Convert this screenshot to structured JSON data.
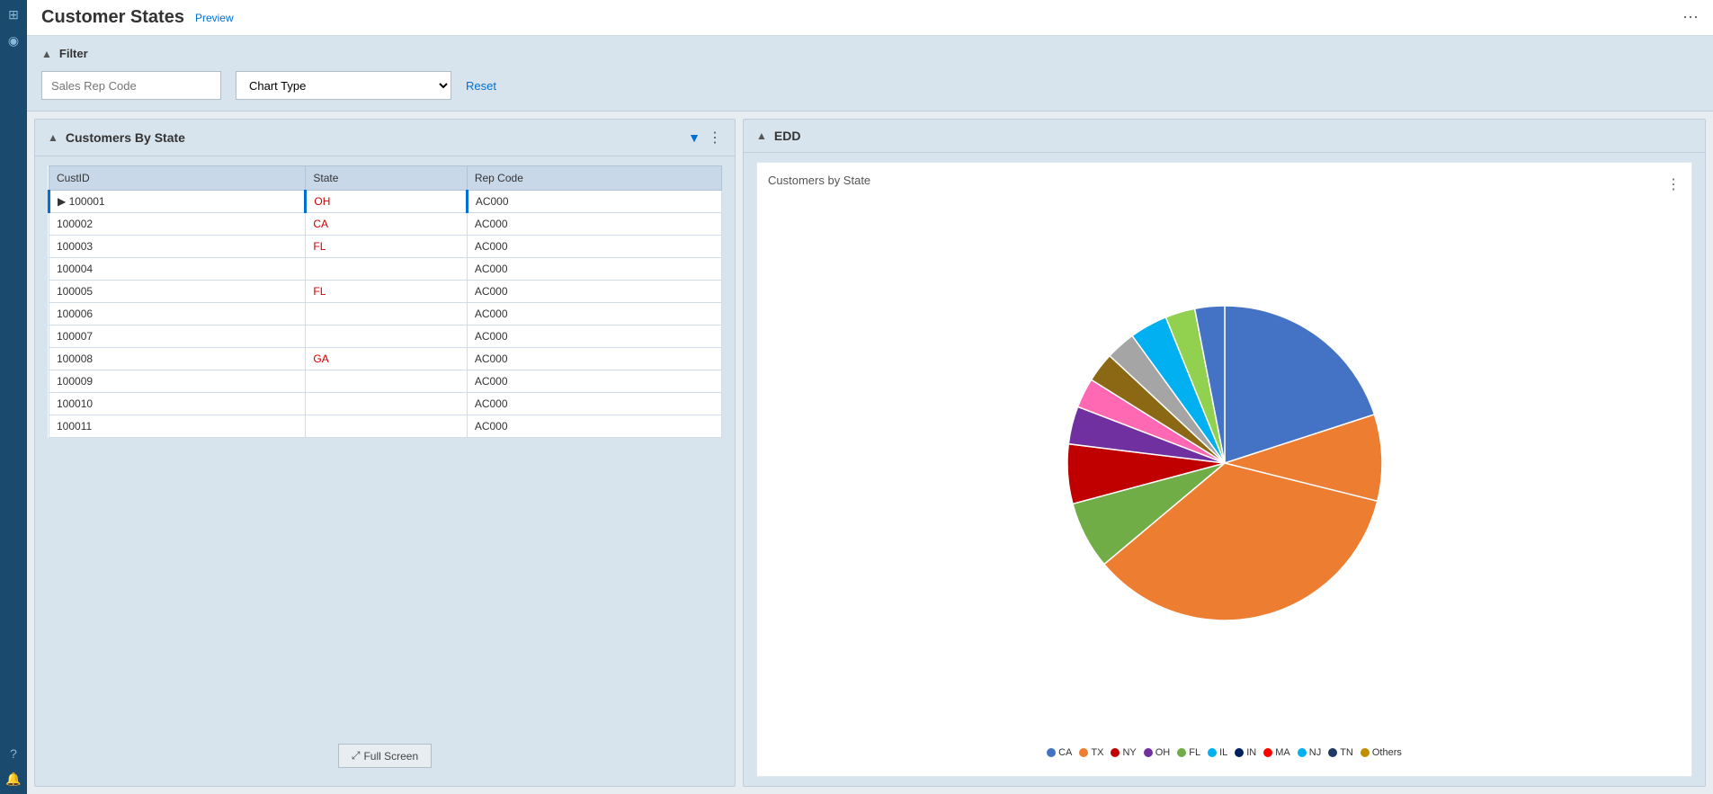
{
  "page": {
    "title": "Customer States",
    "preview_badge": "Preview",
    "header_menu": "⋯"
  },
  "filter": {
    "section_label": "Filter",
    "sales_rep_placeholder": "Sales Rep Code",
    "chart_type_placeholder": "Chart Type",
    "reset_label": "Reset"
  },
  "table_panel": {
    "title": "Customers By State",
    "columns": [
      "CustID",
      "State",
      "Rep Code"
    ],
    "rows": [
      {
        "custid": "100001",
        "state": "OH",
        "state_link": true,
        "repcode": "AC000"
      },
      {
        "custid": "100002",
        "state": "CA",
        "state_link": true,
        "repcode": "AC000"
      },
      {
        "custid": "100003",
        "state": "FL",
        "state_link": true,
        "repcode": "AC000"
      },
      {
        "custid": "100004",
        "state": "",
        "state_link": false,
        "repcode": "AC000"
      },
      {
        "custid": "100005",
        "state": "FL",
        "state_link": true,
        "repcode": "AC000"
      },
      {
        "custid": "100006",
        "state": "",
        "state_link": false,
        "repcode": "AC000"
      },
      {
        "custid": "100007",
        "state": "",
        "state_link": false,
        "repcode": "AC000"
      },
      {
        "custid": "100008",
        "state": "GA",
        "state_link": true,
        "repcode": "AC000"
      },
      {
        "custid": "100009",
        "state": "",
        "state_link": false,
        "repcode": "AC000"
      },
      {
        "custid": "100010",
        "state": "",
        "state_link": false,
        "repcode": "AC000"
      },
      {
        "custid": "100011",
        "state": "",
        "state_link": false,
        "repcode": "AC000"
      }
    ],
    "full_screen_label": "Full Screen"
  },
  "chart_panel": {
    "title": "EDD",
    "chart_subtitle": "Customers by State",
    "legend": [
      {
        "label": "CA",
        "color": "#4472c4"
      },
      {
        "label": "TX",
        "color": "#ed7d31"
      },
      {
        "label": "NY",
        "color": "#c00000"
      },
      {
        "label": "OH",
        "color": "#7030a0"
      },
      {
        "label": "FL",
        "color": "#70ad47"
      },
      {
        "label": "IL",
        "color": "#00b0f0"
      },
      {
        "label": "IN",
        "color": "#002060"
      },
      {
        "label": "MA",
        "color": "#ff0000"
      },
      {
        "label": "NJ",
        "color": "#00b0f0"
      },
      {
        "label": "TN",
        "color": "#1f3864"
      },
      {
        "label": "Others",
        "color": "#bf8f00"
      }
    ],
    "pie_segments": [
      {
        "label": "CA",
        "color": "#4472c4",
        "percent": 20,
        "startAngle": 0,
        "endAngle": 72
      },
      {
        "label": "TX_right",
        "color": "#ed7d31",
        "percent": 9,
        "startAngle": 72,
        "endAngle": 104
      },
      {
        "label": "orange_large",
        "color": "#ed7d31",
        "percent": 35,
        "startAngle": 104,
        "endAngle": 230
      },
      {
        "label": "green",
        "color": "#70ad47",
        "percent": 7,
        "startAngle": 230,
        "endAngle": 255
      },
      {
        "label": "red",
        "color": "#c00000",
        "percent": 6,
        "startAngle": 255,
        "endAngle": 277
      },
      {
        "label": "purple",
        "color": "#7030a0",
        "percent": 4,
        "startAngle": 277,
        "endAngle": 291
      },
      {
        "label": "pink",
        "color": "#ff69b4",
        "percent": 3,
        "startAngle": 291,
        "endAngle": 302
      },
      {
        "label": "brown",
        "color": "#8b6914",
        "percent": 3,
        "startAngle": 302,
        "endAngle": 313
      },
      {
        "label": "gray",
        "color": "#a5a5a5",
        "percent": 3,
        "startAngle": 313,
        "endAngle": 324
      },
      {
        "label": "cyan",
        "color": "#00b0f0",
        "percent": 4,
        "startAngle": 324,
        "endAngle": 338
      },
      {
        "label": "yellow_green",
        "color": "#92d050",
        "percent": 3,
        "startAngle": 338,
        "endAngle": 349
      },
      {
        "label": "blue_small",
        "color": "#4472c4",
        "percent": 3,
        "startAngle": 349,
        "endAngle": 360
      }
    ]
  },
  "sidebar": {
    "icons": [
      "⊞",
      "◉",
      "?",
      "🔔"
    ]
  }
}
